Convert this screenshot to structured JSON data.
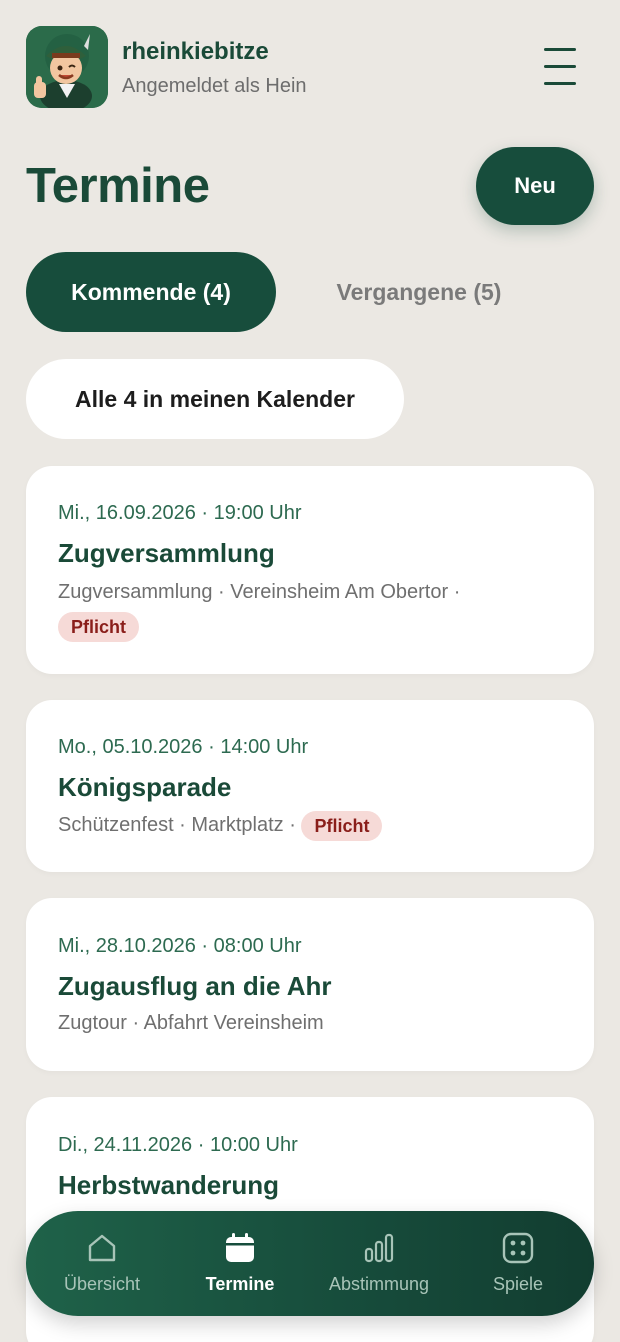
{
  "header": {
    "app_name": "rheinkiebitze",
    "login_info": "Angemeldet als Hein"
  },
  "page": {
    "title": "Termine",
    "new_button": "Neu"
  },
  "tabs": [
    {
      "label": "Kommende (4)",
      "active": true
    },
    {
      "label": "Vergangene (5)",
      "active": false
    }
  ],
  "calendar_button": "Alle 4 in meinen Kalender",
  "events": [
    {
      "date": "Mi., 16.09.2026 · 19:00 Uhr",
      "title": "Zugversammlung",
      "meta": "Zugversammlung · Vereinsheim Am Obertor ·",
      "badge": "Pflicht"
    },
    {
      "date": "Mo., 05.10.2026 · 14:00 Uhr",
      "title": "Königsparade",
      "meta": "Schützenfest · Marktplatz ·",
      "badge": "Pflicht"
    },
    {
      "date": "Mi., 28.10.2026 · 08:00 Uhr",
      "title": "Zugausflug an die Ahr",
      "meta": "Zugtour · Abfahrt Vereinsheim"
    },
    {
      "date": "Di., 24.11.2026 · 10:00 Uhr",
      "title": "Herbstwanderung"
    }
  ],
  "nav": [
    {
      "label": "Übersicht",
      "icon": "home-icon",
      "active": false
    },
    {
      "label": "Termine",
      "icon": "calendar-icon",
      "active": true
    },
    {
      "label": "Abstimmung",
      "icon": "bar-chart-icon",
      "active": false
    },
    {
      "label": "Spiele",
      "icon": "dice-icon",
      "active": false
    }
  ],
  "colors": {
    "brand_green": "#174d3c",
    "background": "#ebe8e3",
    "badge_bg": "#f6dad7",
    "badge_text": "#8a1e1a"
  }
}
